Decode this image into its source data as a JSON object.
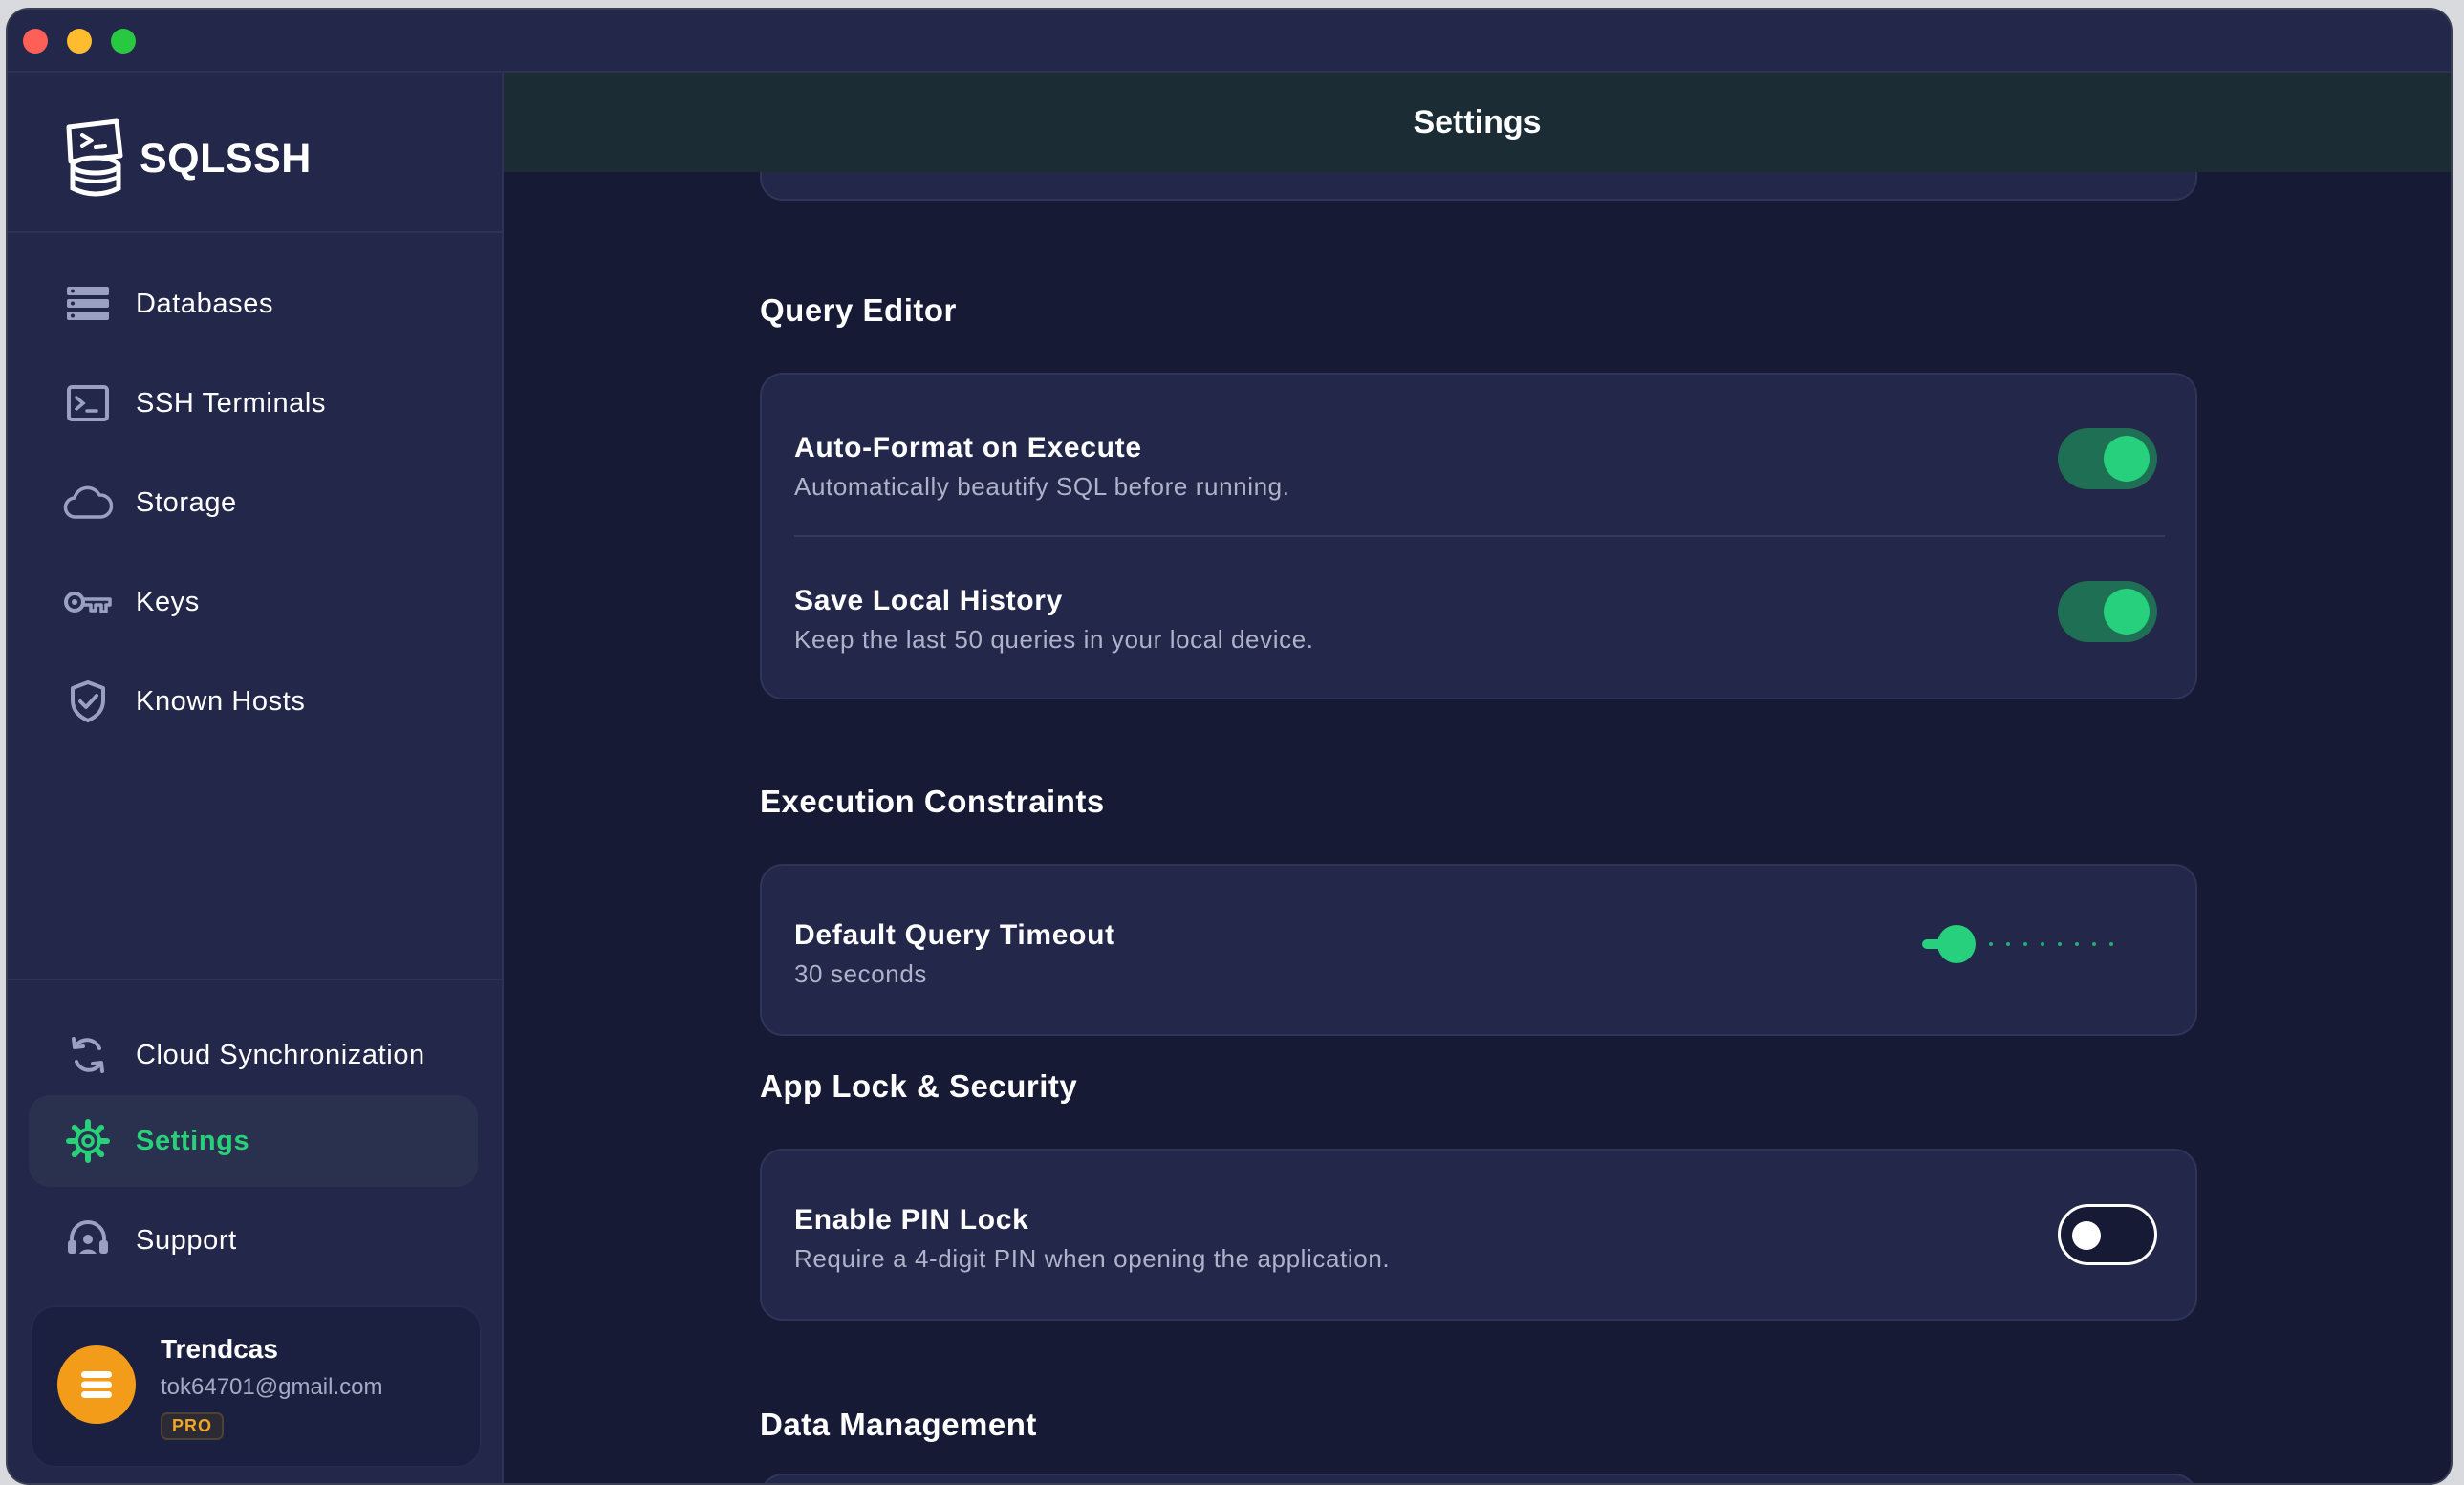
{
  "app": {
    "brand": "SQLSSH"
  },
  "colors": {
    "accent": "#26d07c",
    "background": "#161a35",
    "sidebar": "#23274a",
    "pro_badge": "#f0a623",
    "avatar": "#f39c1a"
  },
  "sidebar": {
    "items": [
      {
        "label": "Databases",
        "icon": "database-list-icon"
      },
      {
        "label": "SSH Terminals",
        "icon": "terminal-icon"
      },
      {
        "label": "Storage",
        "icon": "cloud-icon"
      },
      {
        "label": "Keys",
        "icon": "key-icon"
      },
      {
        "label": "Known Hosts",
        "icon": "shield-check-icon"
      }
    ],
    "bottom_items": [
      {
        "label": "Cloud Synchronization",
        "icon": "sync-icon"
      },
      {
        "label": "Settings",
        "icon": "gear-icon",
        "active": true
      },
      {
        "label": "Support",
        "icon": "headset-icon"
      }
    ],
    "profile": {
      "name": "Trendcas",
      "email": "tok64701@gmail.com",
      "badge": "PRO"
    }
  },
  "header": {
    "title": "Settings"
  },
  "sections": {
    "query_editor": {
      "title": "Query Editor",
      "rows": [
        {
          "title": "Auto-Format on Execute",
          "description": "Automatically beautify SQL before running.",
          "enabled": true
        },
        {
          "title": "Save Local History",
          "description": "Keep the last 50 queries in your local device.",
          "enabled": true
        }
      ]
    },
    "execution": {
      "title": "Execution Constraints",
      "timeout": {
        "title": "Default Query Timeout",
        "value_text": "30 seconds",
        "slider_fraction": 0.0
      }
    },
    "app_lock": {
      "title": "App Lock & Security",
      "pin": {
        "title": "Enable PIN Lock",
        "description": "Require a 4-digit PIN when opening the application.",
        "enabled": false
      }
    },
    "data_management": {
      "title": "Data Management"
    }
  }
}
